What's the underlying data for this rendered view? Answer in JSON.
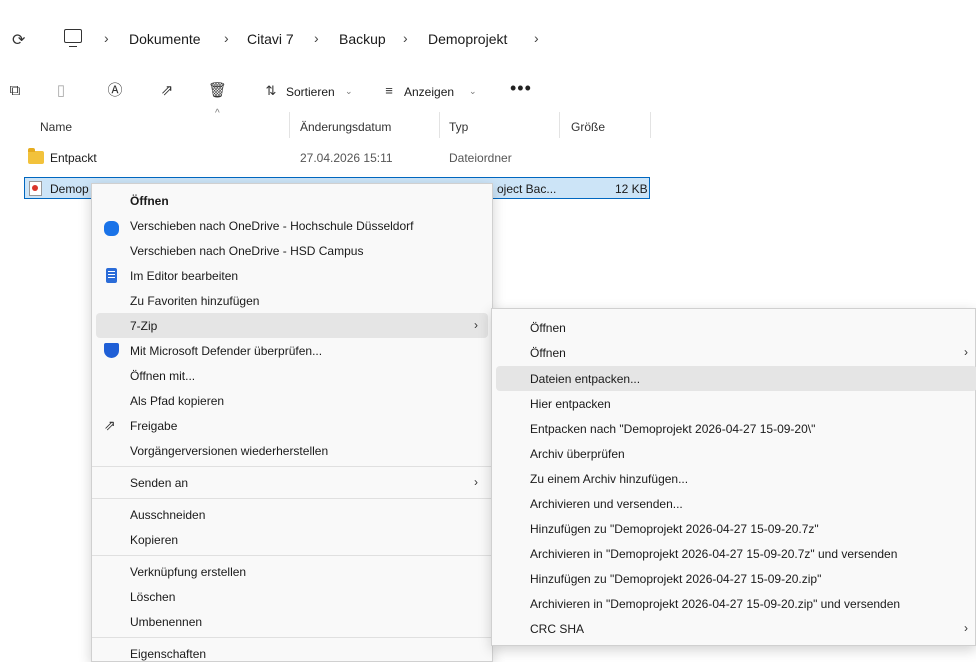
{
  "breadcrumb": [
    "Dokumente",
    "Citavi 7",
    "Backup",
    "Demoprojekt"
  ],
  "icons": {
    "refresh": "⟳",
    "separator": "›",
    "new": "new-icon",
    "paste": "paste-icon",
    "rename": "rename-icon",
    "share": "share-icon",
    "delete": "delete-icon"
  },
  "toolbar": {
    "sort_label": "Sortieren",
    "view_label": "Anzeigen",
    "more_label": "•••"
  },
  "columns": {
    "name": "Name",
    "date": "Änderungsdatum",
    "type": "Typ",
    "size": "Größe"
  },
  "files": [
    {
      "name": "Entpackt",
      "date": "27.04.2026 15:11",
      "type": "Dateiordner",
      "size": ""
    },
    {
      "name": "Demop",
      "date": "",
      "type": "oject Bac...",
      "size": "12 KB"
    }
  ],
  "context_menu": {
    "items": [
      "Öffnen",
      "Verschieben nach OneDrive - Hochschule Düsseldorf",
      "Verschieben nach OneDrive - HSD Campus",
      "Im Editor bearbeiten",
      "Zu Favoriten hinzufügen",
      "7-Zip",
      "Mit Microsoft Defender überprüfen...",
      "Öffnen mit...",
      "Als Pfad kopieren",
      "Freigabe",
      "Vorgängerversionen wiederherstellen",
      "Senden an",
      "Ausschneiden",
      "Kopieren",
      "Verknüpfung erstellen",
      "Löschen",
      "Umbenennen",
      "Eigenschaften"
    ]
  },
  "submenu_7zip": {
    "items": [
      "Öffnen",
      "Öffnen",
      "Dateien entpacken...",
      "Hier entpacken",
      "Entpacken nach \"Demoprojekt 2026-04-27 15-09-20\\\"",
      "Archiv überprüfen",
      "Zu einem Archiv hinzufügen...",
      "Archivieren und versenden...",
      "Hinzufügen zu \"Demoprojekt 2026-04-27 15-09-20.7z\"",
      "Archivieren in \"Demoprojekt 2026-04-27 15-09-20.7z\" und versenden",
      "Hinzufügen zu \"Demoprojekt 2026-04-27 15-09-20.zip\"",
      "Archivieren in \"Demoprojekt 2026-04-27 15-09-20.zip\" und versenden",
      "CRC SHA"
    ]
  },
  "colors": {
    "accent": "#0067c0",
    "selection": "#cce4f7",
    "hover": "#e5e5e5",
    "folder": "#f2c23b"
  }
}
